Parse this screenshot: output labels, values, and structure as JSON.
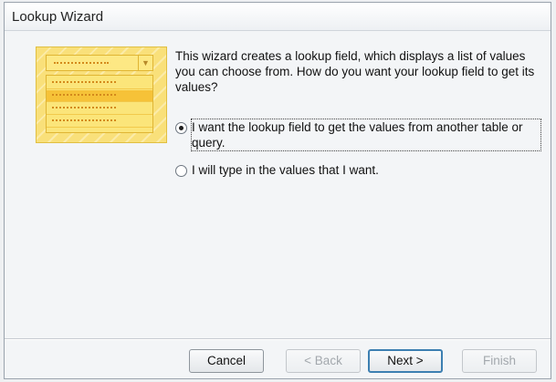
{
  "window": {
    "title": "Lookup Wizard"
  },
  "intro_text": "This wizard creates a lookup field, which displays a list of values you can choose from.  How do you want your lookup field to get its values?",
  "options": [
    {
      "label": "I want the lookup field to get the values from another table or query.",
      "selected": true
    },
    {
      "label": "I will type in the values that I want.",
      "selected": false
    }
  ],
  "buttons": {
    "cancel": "Cancel",
    "back": "< Back",
    "next": "Next >",
    "finish": "Finish"
  },
  "colors": {
    "art_background": "#f9e07a",
    "default_button_border": "#3c7fb1"
  }
}
